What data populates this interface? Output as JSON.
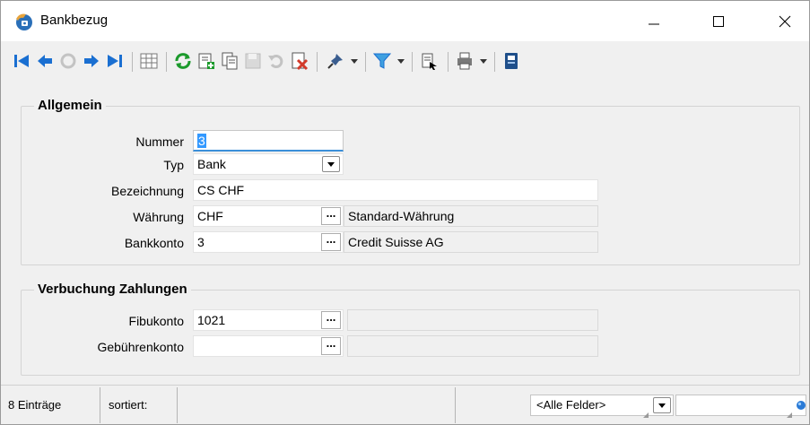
{
  "window": {
    "title": "Bankbezug",
    "controls": {
      "minimize": "–",
      "maximize": "☐",
      "close": "✕"
    }
  },
  "toolbar": {
    "icons": [
      "first-record-icon",
      "prev-record-icon",
      "undo-disabled-icon",
      "next-record-icon",
      "last-record-icon",
      "table-view-icon",
      "refresh-icon",
      "new-record-icon",
      "copy-record-icon",
      "save-disabled-icon",
      "undo-icon",
      "delete-record-icon",
      "pin-icon",
      "filter-icon",
      "export-icon",
      "print-icon",
      "form-icon"
    ],
    "colors": {
      "nav_blue": "#1a6fd1",
      "refresh_green": "#1c9a2c",
      "delete_red": "#d23a2a"
    }
  },
  "allgemein": {
    "title": "Allgemein",
    "nummer": {
      "label": "Nummer",
      "value": "3"
    },
    "typ": {
      "label": "Typ",
      "value": "Bank"
    },
    "bezeichnung": {
      "label": "Bezeichnung",
      "value": "CS CHF"
    },
    "waehrung": {
      "label": "Währung",
      "value": "CHF",
      "description": "Standard-Währung"
    },
    "bankkonto": {
      "label": "Bankkonto",
      "value": "3",
      "description": "Credit Suisse AG"
    }
  },
  "verbuchung": {
    "title": "Verbuchung Zahlungen",
    "fibukonto": {
      "label": "Fibukonto",
      "value": "1021",
      "description": ""
    },
    "gebuehrenkonto": {
      "label": "Gebührenkonto",
      "value": "",
      "description": ""
    }
  },
  "lookup_button_label": "...",
  "statusbar": {
    "count": "8 Einträge",
    "sort_label": "sortiert:",
    "field_filter": "<Alle Felder>",
    "search_value": ""
  }
}
